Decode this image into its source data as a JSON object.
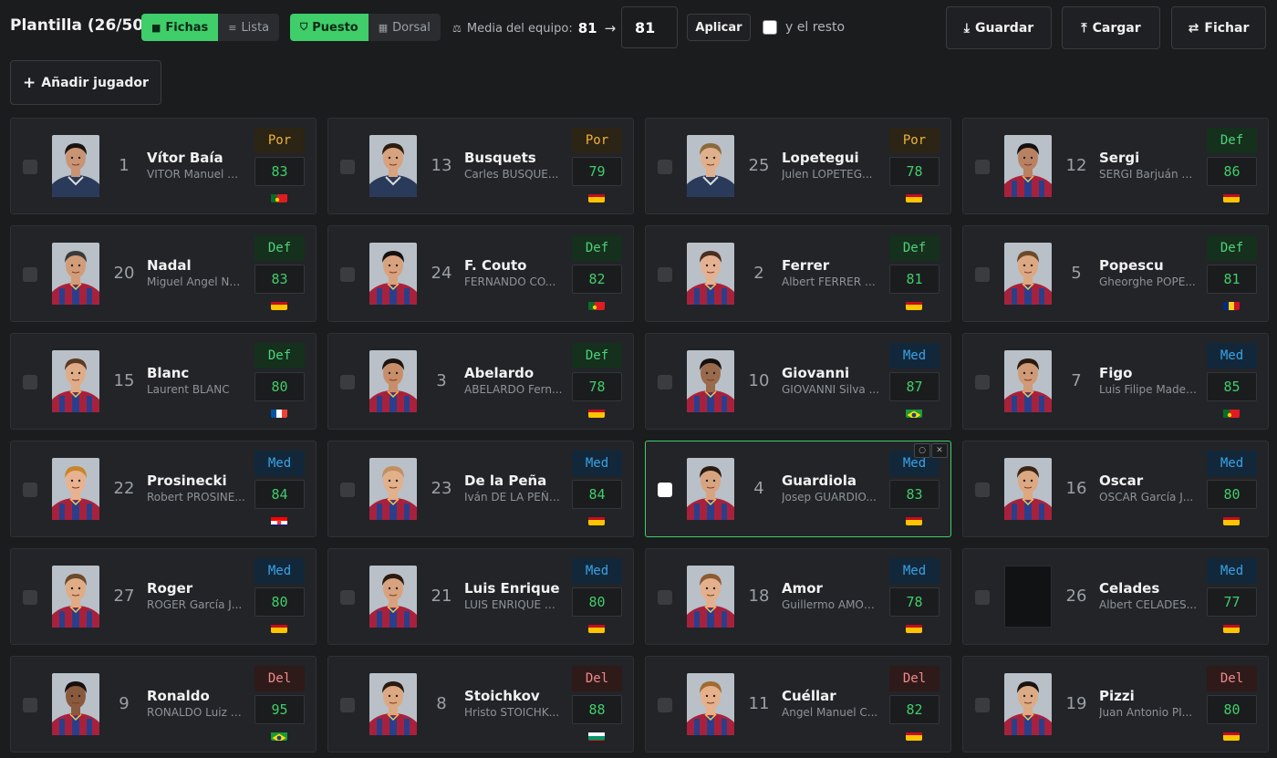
{
  "header": {
    "title": "Plantilla (26/50)",
    "view_cards": "Fichas",
    "view_list": "Lista",
    "sort_position": "Puesto",
    "sort_number": "Dorsal",
    "team_avg_label": "Media del equipo:",
    "team_avg_value": "81",
    "target_input": "81",
    "apply": "Aplicar",
    "rest_label": "y el resto",
    "save": "Guardar",
    "load": "Cargar",
    "swap": "Fichar",
    "add_player": "Añadir jugador"
  },
  "colors": {
    "accent": "#3fce6a",
    "por": "#f0b23b",
    "def": "#4ed27a",
    "med": "#3aa2e6",
    "del": "#f08a8a"
  },
  "players": [
    {
      "num": "1",
      "name": "Vítor Baía",
      "full": "VITOR Manuel M...",
      "pos": "Por",
      "rating": "83",
      "flag": "portugal",
      "photo": true,
      "skin": "#c89474",
      "hair": "#1a1410",
      "kit": "gk"
    },
    {
      "num": "13",
      "name": "Busquets",
      "full": "Carles BUSQUE...",
      "pos": "Por",
      "rating": "79",
      "flag": "spain",
      "photo": true,
      "skin": "#d8a27e",
      "hair": "#2a1c12",
      "kit": "gk"
    },
    {
      "num": "25",
      "name": "Lopetegui",
      "full": "Julen LOPETEG...",
      "pos": "Por",
      "rating": "78",
      "flag": "spain",
      "photo": true,
      "skin": "#e0b08c",
      "hair": "#8a6a3a",
      "kit": "gk"
    },
    {
      "num": "12",
      "name": "Sergi",
      "full": "SERGI Barjuán E...",
      "pos": "Def",
      "rating": "86",
      "flag": "spain",
      "photo": true,
      "skin": "#b88262",
      "hair": "#151010",
      "kit": "fcb"
    },
    {
      "num": "20",
      "name": "Nadal",
      "full": "Miguel Angel NA...",
      "pos": "Def",
      "rating": "83",
      "flag": "spain",
      "photo": true,
      "skin": "#d29c78",
      "hair": "#3a3a3a",
      "kit": "fcb"
    },
    {
      "num": "24",
      "name": "F. Couto",
      "full": "FERNANDO CO...",
      "pos": "Def",
      "rating": "82",
      "flag": "portugal",
      "photo": true,
      "skin": "#d8a27e",
      "hair": "#161010",
      "kit": "fcb"
    },
    {
      "num": "2",
      "name": "Ferrer",
      "full": "Albert FERRER L...",
      "pos": "Def",
      "rating": "81",
      "flag": "spain",
      "photo": true,
      "skin": "#e4b292",
      "hair": "#4a3020",
      "kit": "fcb"
    },
    {
      "num": "5",
      "name": "Popescu",
      "full": "Gheorghe POPE...",
      "pos": "Def",
      "rating": "81",
      "flag": "romania",
      "photo": true,
      "skin": "#dca882",
      "hair": "#6a4a2a",
      "kit": "fcb"
    },
    {
      "num": "15",
      "name": "Blanc",
      "full": "Laurent BLANC",
      "pos": "Def",
      "rating": "80",
      "flag": "france",
      "photo": true,
      "skin": "#e0ac88",
      "hair": "#5a3a22",
      "kit": "fcb"
    },
    {
      "num": "3",
      "name": "Abelardo",
      "full": "ABELARDO Fern...",
      "pos": "Def",
      "rating": "78",
      "flag": "spain",
      "photo": true,
      "skin": "#c88e6a",
      "hair": "#1a1410",
      "kit": "fcb"
    },
    {
      "num": "10",
      "name": "Giovanni",
      "full": "GIOVANNI Silva ...",
      "pos": "Med",
      "rating": "87",
      "flag": "brazil",
      "photo": true,
      "skin": "#9a6a4c",
      "hair": "#151010",
      "kit": "fcb"
    },
    {
      "num": "7",
      "name": "Figo",
      "full": "Luis Filipe Madei...",
      "pos": "Med",
      "rating": "85",
      "flag": "portugal",
      "photo": true,
      "skin": "#d09a76",
      "hair": "#2a1a10",
      "kit": "fcb"
    },
    {
      "num": "22",
      "name": "Prosinecki",
      "full": "Robert PROSINE...",
      "pos": "Med",
      "rating": "84",
      "flag": "croatia",
      "photo": true,
      "skin": "#e8b290",
      "hair": "#c8862a",
      "kit": "fcb"
    },
    {
      "num": "23",
      "name": "De la Peña",
      "full": "Iván DE LA PEÑA...",
      "pos": "Med",
      "rating": "84",
      "flag": "spain",
      "photo": true,
      "skin": "#e2b08a",
      "hair": "#c09060",
      "kit": "fcb"
    },
    {
      "num": "4",
      "name": "Guardiola",
      "full": "Josep GUARDIO...",
      "pos": "Med",
      "rating": "83",
      "flag": "spain",
      "photo": true,
      "skin": "#d8a480",
      "hair": "#2a1c12",
      "kit": "fcb",
      "selected": true
    },
    {
      "num": "16",
      "name": "Oscar",
      "full": "OSCAR García J...",
      "pos": "Med",
      "rating": "80",
      "flag": "spain",
      "photo": true,
      "skin": "#dca882",
      "hair": "#3a2618",
      "kit": "fcb"
    },
    {
      "num": "27",
      "name": "Roger",
      "full": "ROGER García J...",
      "pos": "Med",
      "rating": "80",
      "flag": "spain",
      "photo": true,
      "skin": "#e0ac86",
      "hair": "#6a4a2a",
      "kit": "fcb"
    },
    {
      "num": "21",
      "name": "Luis Enrique",
      "full": "LUIS ENRIQUE M...",
      "pos": "Med",
      "rating": "80",
      "flag": "spain",
      "photo": true,
      "skin": "#d8a27e",
      "hair": "#2a1a10",
      "kit": "fcb"
    },
    {
      "num": "18",
      "name": "Amor",
      "full": "Guillermo AMOR...",
      "pos": "Med",
      "rating": "78",
      "flag": "spain",
      "photo": true,
      "skin": "#e4b08c",
      "hair": "#8a5a30",
      "kit": "fcb"
    },
    {
      "num": "26",
      "name": "Celades",
      "full": "Albert CELADES...",
      "pos": "Med",
      "rating": "77",
      "flag": "spain",
      "photo": false
    },
    {
      "num": "9",
      "name": "Ronaldo",
      "full": "RONALDO Luiz N...",
      "pos": "Del",
      "rating": "95",
      "flag": "brazil",
      "photo": true,
      "skin": "#8a5a3e",
      "hair": "#151010",
      "kit": "fcb"
    },
    {
      "num": "8",
      "name": "Stoichkov",
      "full": "Hristo STOICHK...",
      "pos": "Del",
      "rating": "88",
      "flag": "bulgaria",
      "photo": true,
      "skin": "#dca882",
      "hair": "#2a1a10",
      "kit": "fcb"
    },
    {
      "num": "11",
      "name": "Cuéllar",
      "full": "Angel Manuel C...",
      "pos": "Del",
      "rating": "82",
      "flag": "spain",
      "photo": true,
      "skin": "#e6b08a",
      "hair": "#a06a30",
      "kit": "fcb"
    },
    {
      "num": "19",
      "name": "Pizzi",
      "full": "Juan Antonio PI...",
      "pos": "Del",
      "rating": "80",
      "flag": "spain",
      "photo": true,
      "skin": "#dcaa84",
      "hair": "#1a1410",
      "kit": "fcb"
    }
  ]
}
